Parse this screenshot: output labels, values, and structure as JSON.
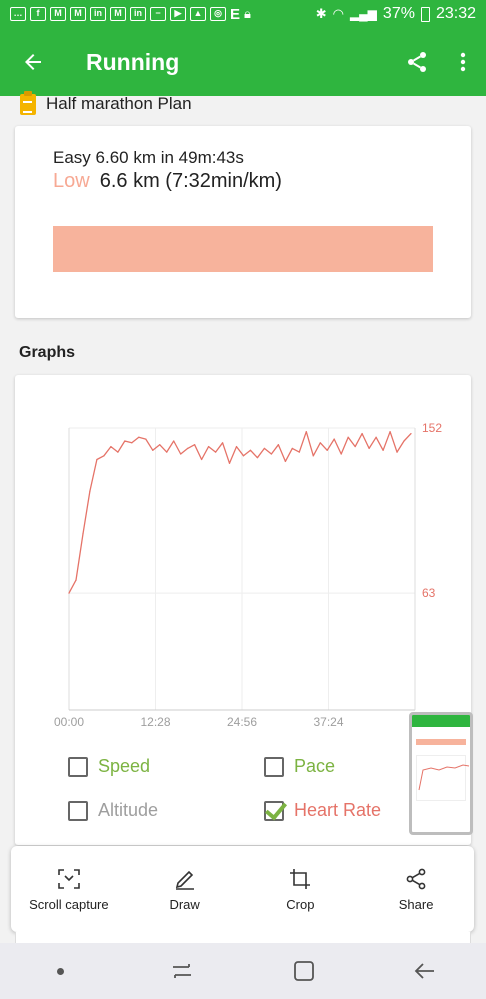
{
  "status_bar": {
    "battery": "37%",
    "time": "23:32"
  },
  "app_bar": {
    "title": "Running"
  },
  "plan": {
    "title": "Half marathon Plan",
    "summary": "Easy 6.60 km in 49m:43s",
    "zone": "Low",
    "detail": "6.6 km (7:32min/km)",
    "bar_color": "#f7b39c"
  },
  "graphs": {
    "title": "Graphs"
  },
  "chart_data": {
    "type": "line",
    "series": [
      {
        "name": "Heart Rate",
        "color": "#e57368",
        "x": [
          "00:00",
          "01:00",
          "02:00",
          "03:00",
          "04:00",
          "05:00",
          "06:00",
          "07:00",
          "08:00",
          "09:00",
          "10:00",
          "11:00",
          "12:00",
          "13:00",
          "14:00",
          "15:00",
          "16:00",
          "17:00",
          "18:00",
          "19:00",
          "20:00",
          "21:00",
          "22:00",
          "23:00",
          "24:00",
          "25:00",
          "26:00",
          "27:00",
          "28:00",
          "29:00",
          "30:00",
          "31:00",
          "32:00",
          "33:00",
          "34:00",
          "35:00",
          "36:00",
          "37:00",
          "38:00",
          "39:00",
          "40:00",
          "41:00",
          "42:00",
          "43:00",
          "44:00",
          "45:00",
          "46:00",
          "47:00",
          "48:00",
          "49:00"
        ],
        "values": [
          63,
          70,
          95,
          118,
          135,
          137,
          142,
          139,
          145,
          144,
          147,
          146,
          140,
          143,
          139,
          145,
          138,
          141,
          143,
          135,
          142,
          139,
          144,
          133,
          142,
          137,
          140,
          136,
          141,
          138,
          143,
          134,
          141,
          139,
          150,
          137,
          144,
          140,
          146,
          138,
          147,
          142,
          149,
          141,
          147,
          140,
          150,
          139,
          145,
          149
        ]
      }
    ],
    "x_ticks": [
      "00:00",
      "12:28",
      "24:56",
      "37:24"
    ],
    "y_ticks": [
      63,
      152
    ],
    "ylim": [
      0,
      152
    ]
  },
  "toggles": [
    {
      "label": "Speed",
      "checked": false,
      "color": "#7cb342"
    },
    {
      "label": "Pace",
      "checked": false,
      "color": "#7cb342"
    },
    {
      "label": "Altitude",
      "checked": false,
      "color": "#9e9e9e"
    },
    {
      "label": "Heart Rate",
      "checked": true,
      "color": "#e57368"
    }
  ],
  "capture_toolbar": {
    "scroll_capture": "Scroll capture",
    "draw": "Draw",
    "crop": "Crop",
    "share": "Share"
  },
  "colors": {
    "brand": "#2fb53f",
    "heart_rate": "#e57368",
    "plan_zone": "#f7a994"
  }
}
